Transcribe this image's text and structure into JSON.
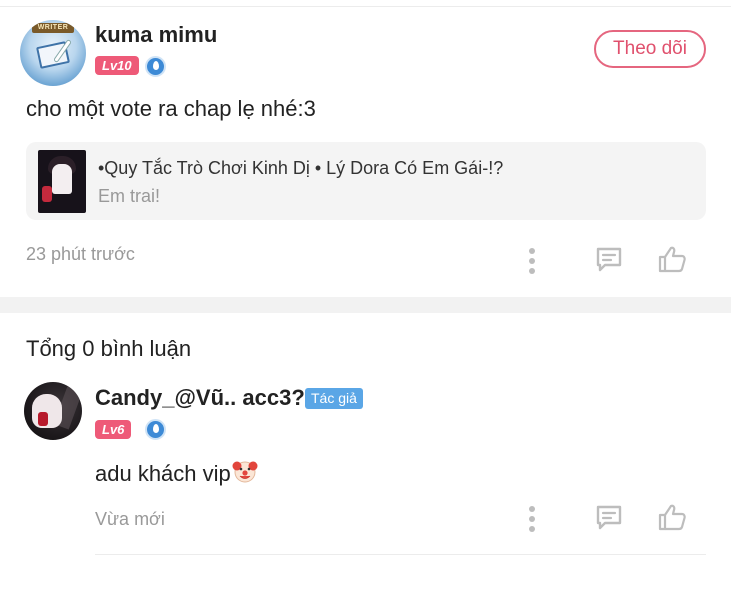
{
  "post": {
    "username": "kuma mimu",
    "level": "Lv10",
    "follow_label": "Theo dõi",
    "text": "cho một vote ra chap lẹ nhé:3",
    "linked_story": {
      "title": "•Quy Tắc Trò Chơi Kinh Dị • Lý Dora Có Em Gái-!?",
      "subtitle": "Em trai!"
    },
    "time": "23 phút trước",
    "icons": [
      "more-icon",
      "comment-icon",
      "like-icon"
    ]
  },
  "comments": {
    "title": "Tổng 0 bình luận",
    "items": [
      {
        "username": "Candy_@Vũ.. acc3?",
        "badge": "Tác giả",
        "level": "Lv6",
        "text": "adu khách vip",
        "emoji": "clown-face-icon",
        "time": "Vừa mới"
      }
    ]
  },
  "colors": {
    "accent": "#e5667f",
    "level_badge": "#ee5a78",
    "author_badge": "#5aa6e6",
    "muted_text": "#999999",
    "card_bg": "#f4f4f4"
  }
}
